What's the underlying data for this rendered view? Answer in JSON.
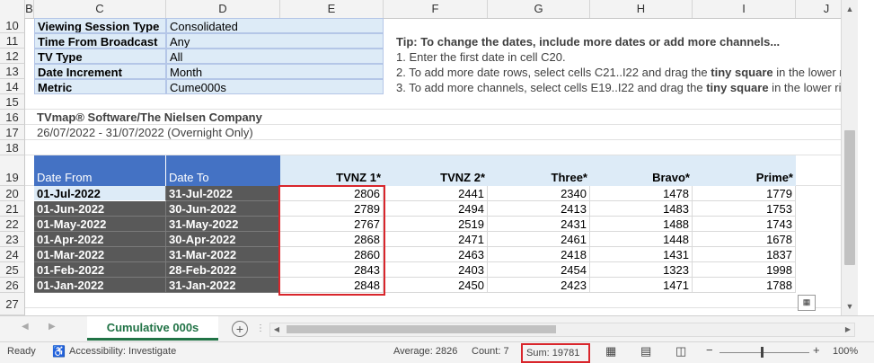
{
  "columns": [
    "B",
    "C",
    "D",
    "E",
    "F",
    "G",
    "H",
    "I",
    "J"
  ],
  "rows": [
    "10",
    "11",
    "12",
    "13",
    "14",
    "15",
    "16",
    "17",
    "18",
    "19",
    "20",
    "21",
    "22",
    "23",
    "24",
    "25",
    "26",
    "27"
  ],
  "params": [
    {
      "label": "Viewing Session Type",
      "value": "Consolidated"
    },
    {
      "label": "Time From Broadcast",
      "value": "Any"
    },
    {
      "label": "TV Type",
      "value": "All"
    },
    {
      "label": "Date Increment",
      "value": "Month"
    },
    {
      "label": "Metric",
      "value": "Cume000s"
    }
  ],
  "tip": {
    "title": "Tip:  To change the dates, include more dates or add more channels...",
    "line1": "1. Enter the first date in cell C20.",
    "line2a": "2. To add more date rows, select cells C21..I22 and drag the ",
    "line2b": "tiny square",
    "line2c": " in the lower rig",
    "line3a": "3. To add more channels, select cells E19..I22 and drag the ",
    "line3b": "tiny square",
    "line3c": " in the lower righ"
  },
  "source": "TVmap® Software/The Nielsen Company",
  "period": "26/07/2022 - 31/07/2022 (Overnight Only)",
  "table": {
    "headers": [
      "Date From",
      "Date To",
      "TVNZ 1*",
      "TVNZ 2*",
      "Three*",
      "Bravo*",
      "Prime*"
    ],
    "rows": [
      [
        "01-Jul-2022",
        "31-Jul-2022",
        "2806",
        "2441",
        "2340",
        "1478",
        "1779"
      ],
      [
        "01-Jun-2022",
        "30-Jun-2022",
        "2789",
        "2494",
        "2413",
        "1483",
        "1753"
      ],
      [
        "01-May-2022",
        "31-May-2022",
        "2767",
        "2519",
        "2431",
        "1488",
        "1743"
      ],
      [
        "01-Apr-2022",
        "30-Apr-2022",
        "2868",
        "2471",
        "2461",
        "1448",
        "1678"
      ],
      [
        "01-Mar-2022",
        "31-Mar-2022",
        "2860",
        "2463",
        "2418",
        "1431",
        "1837"
      ],
      [
        "01-Feb-2022",
        "28-Feb-2022",
        "2843",
        "2403",
        "2454",
        "1323",
        "1998"
      ],
      [
        "01-Jan-2022",
        "31-Jan-2022",
        "2848",
        "2450",
        "2423",
        "1471",
        "1788"
      ]
    ]
  },
  "sheet_tab": "Cumulative 000s",
  "status": {
    "ready": "Ready",
    "accessibility": "Accessibility: Investigate",
    "average": "Average: 2826",
    "count": "Count: 7",
    "sum": "Sum: 19781",
    "zoom": "100%"
  },
  "colors": {
    "accent": "#4472c4",
    "dark_cell": "#595959",
    "light_cell": "#ddebf7",
    "highlight": "#d9262c",
    "tab_green": "#217346"
  }
}
